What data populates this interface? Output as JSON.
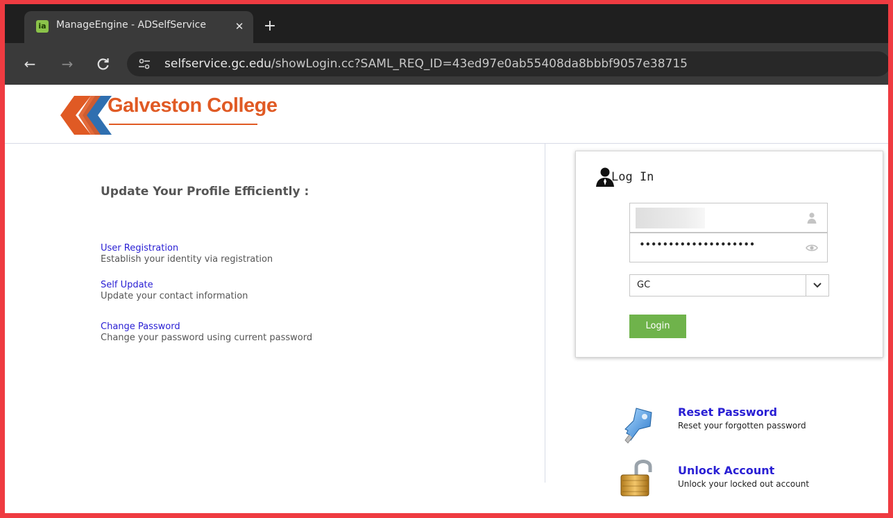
{
  "browser": {
    "tab_title": "ManageEngine - ADSelfService",
    "favicon_text": "ia",
    "tab_close_icon": "close-icon",
    "new_tab_icon": "plus-icon",
    "url_domain": "selfservice.gc.edu",
    "url_path": "/showLogin.cc?SAML_REQ_ID=43ed97e0ab55408da8bbbf9057e38715",
    "nav_icons": [
      "back-arrow-icon",
      "forward-arrow-icon",
      "reload-icon",
      "site-info-icon"
    ]
  },
  "header": {
    "logo_text": "Galveston College"
  },
  "left": {
    "heading": "Update Your Profile Efficiently :",
    "features": [
      {
        "link": "User Registration",
        "description": "Establish your identity via registration"
      },
      {
        "link": "Self Update",
        "description": "Update your contact information"
      },
      {
        "link": "Change Password",
        "description": "Change your password using current password"
      }
    ]
  },
  "login": {
    "title": "Log In",
    "password_masked": "••••••••••••••••••••",
    "domain_selected": "GC",
    "login_button": "Login"
  },
  "actions": [
    {
      "title": "Reset Password",
      "description": "Reset your forgotten password",
      "icon": "key-icon"
    },
    {
      "title": "Unlock Account",
      "description": "Unlock your locked out account",
      "icon": "padlock-icon"
    }
  ],
  "colors": {
    "accent_link": "#2a20d4",
    "login_button": "#6fb34b",
    "logo_orange": "#e05a24",
    "logo_blue": "#2f6fb0",
    "frame": "#ef3b41"
  }
}
